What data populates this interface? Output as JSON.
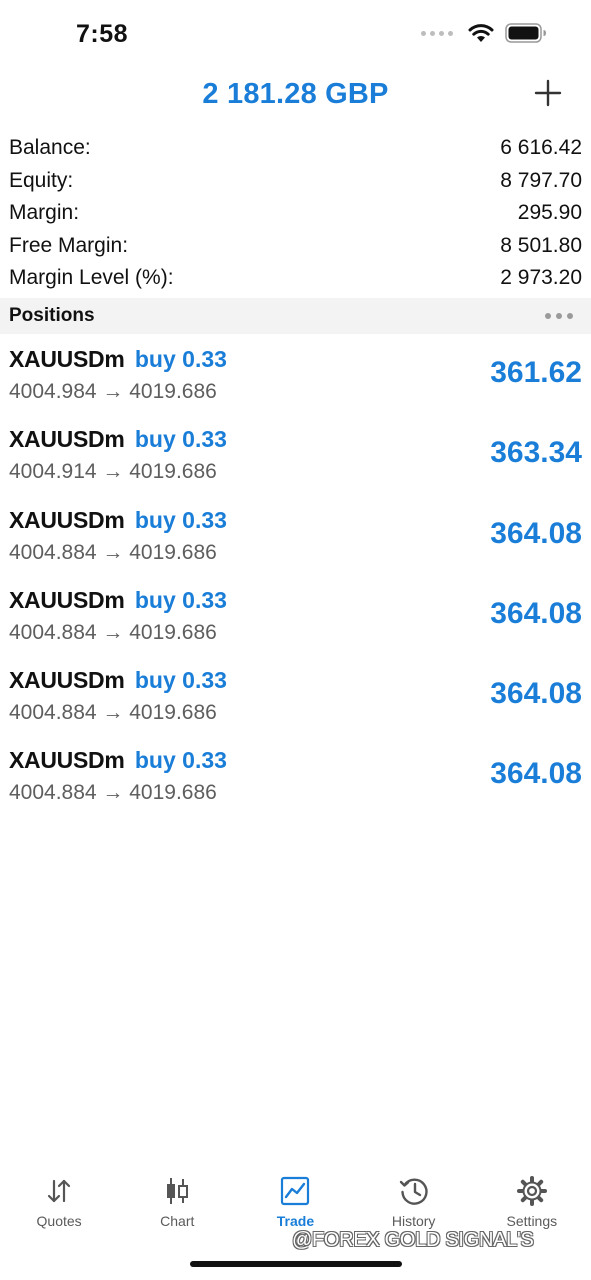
{
  "status_bar": {
    "time": "7:58"
  },
  "header": {
    "title": "2 181.28 GBP"
  },
  "summary": [
    {
      "label": "Balance:",
      "value": "6 616.42"
    },
    {
      "label": "Equity:",
      "value": "8 797.70"
    },
    {
      "label": "Margin:",
      "value": "295.90"
    },
    {
      "label": "Free Margin:",
      "value": "8 501.80"
    },
    {
      "label": "Margin Level (%):",
      "value": "2 973.20"
    }
  ],
  "positions_section": {
    "title": "Positions"
  },
  "positions": [
    {
      "symbol": "XAUUSDm",
      "direction": "buy 0.33",
      "prices": "4004.984 → 4019.686",
      "profit": "361.62"
    },
    {
      "symbol": "XAUUSDm",
      "direction": "buy 0.33",
      "prices": "4004.914 → 4019.686",
      "profit": "363.34"
    },
    {
      "symbol": "XAUUSDm",
      "direction": "buy 0.33",
      "prices": "4004.884 → 4019.686",
      "profit": "364.08"
    },
    {
      "symbol": "XAUUSDm",
      "direction": "buy 0.33",
      "prices": "4004.884 → 4019.686",
      "profit": "364.08"
    },
    {
      "symbol": "XAUUSDm",
      "direction": "buy 0.33",
      "prices": "4004.884 → 4019.686",
      "profit": "364.08"
    },
    {
      "symbol": "XAUUSDm",
      "direction": "buy 0.33",
      "prices": "4004.884 → 4019.686",
      "profit": "364.08"
    }
  ],
  "tabs": [
    {
      "label": "Quotes",
      "icon": "quotes-arrows-icon",
      "active": false
    },
    {
      "label": "Chart",
      "icon": "candlestick-chart-icon",
      "active": false
    },
    {
      "label": "Trade",
      "icon": "trade-chart-icon",
      "active": true
    },
    {
      "label": "History",
      "icon": "history-clock-icon",
      "active": false
    },
    {
      "label": "Settings",
      "icon": "gear-icon",
      "active": false
    }
  ],
  "watermark": "@FOREX GOLD SIGNAL'S",
  "colors": {
    "accent": "#1a7ed8",
    "text": "#111111",
    "secondary_text": "#5e5e5e",
    "section_bg": "#f3f3f3"
  }
}
